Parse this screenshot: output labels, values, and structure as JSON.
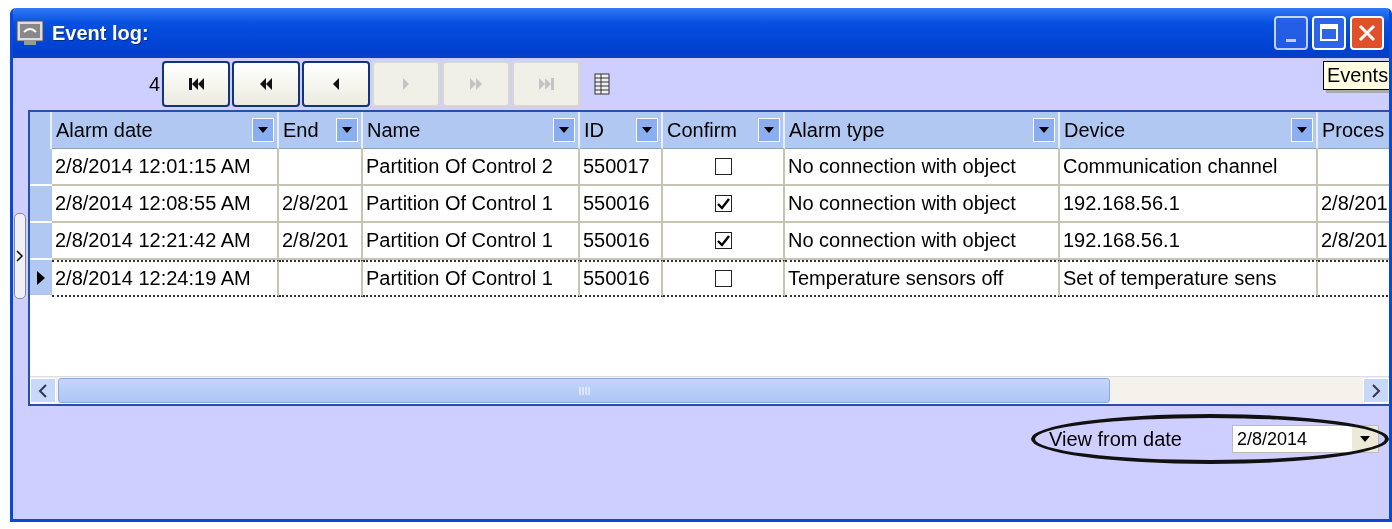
{
  "window": {
    "title": "Event log:"
  },
  "navigator": {
    "record_count": "4",
    "buttons": [
      {
        "kind": "first",
        "disabled": false
      },
      {
        "kind": "prev-page",
        "disabled": false
      },
      {
        "kind": "prev",
        "disabled": false
      },
      {
        "kind": "next",
        "disabled": true
      },
      {
        "kind": "next-page",
        "disabled": true
      },
      {
        "kind": "last",
        "disabled": true
      }
    ]
  },
  "tooltip": "Events",
  "table": {
    "columns": [
      {
        "label": "Alarm date",
        "has_filter": true
      },
      {
        "label": "End",
        "has_filter": true
      },
      {
        "label": "Name",
        "has_filter": true
      },
      {
        "label": "ID",
        "has_filter": true
      },
      {
        "label": "Confirm",
        "has_filter": true
      },
      {
        "label": "Alarm type",
        "has_filter": true
      },
      {
        "label": "Device",
        "has_filter": true
      },
      {
        "label": "Proces",
        "has_filter": false
      }
    ],
    "rows": [
      {
        "selected": false,
        "alarm_date": "2/8/2014 12:01:15 AM",
        "name": "Partition Of Control 2",
        "id": "550017",
        "confirmed": false,
        "alarm_type": "No connection with object",
        "device": "Communication channel"
      },
      {
        "selected": false,
        "alarm_date": "2/8/2014 12:08:55 AM",
        "end": "2/8/201",
        "name": "Partition Of Control 1",
        "id": "550016",
        "confirmed": true,
        "alarm_type": "No connection with object",
        "device": "192.168.56.1",
        "process": "2/8/201"
      },
      {
        "selected": false,
        "alarm_date": "2/8/2014 12:21:42 AM",
        "end": "2/8/201",
        "name": "Partition Of Control 1",
        "id": "550016",
        "confirmed": true,
        "alarm_type": "No connection with object",
        "device": "192.168.56.1",
        "process": "2/8/201"
      },
      {
        "selected": true,
        "alarm_date": "2/8/2014 12:24:19 AM",
        "name": "Partition Of Control 1",
        "id": "550016",
        "confirmed": false,
        "alarm_type": "Temperature sensors off",
        "device": "Set of temperature sens"
      }
    ]
  },
  "date_filter": {
    "label": "View from date",
    "value": "2/8/2014"
  }
}
